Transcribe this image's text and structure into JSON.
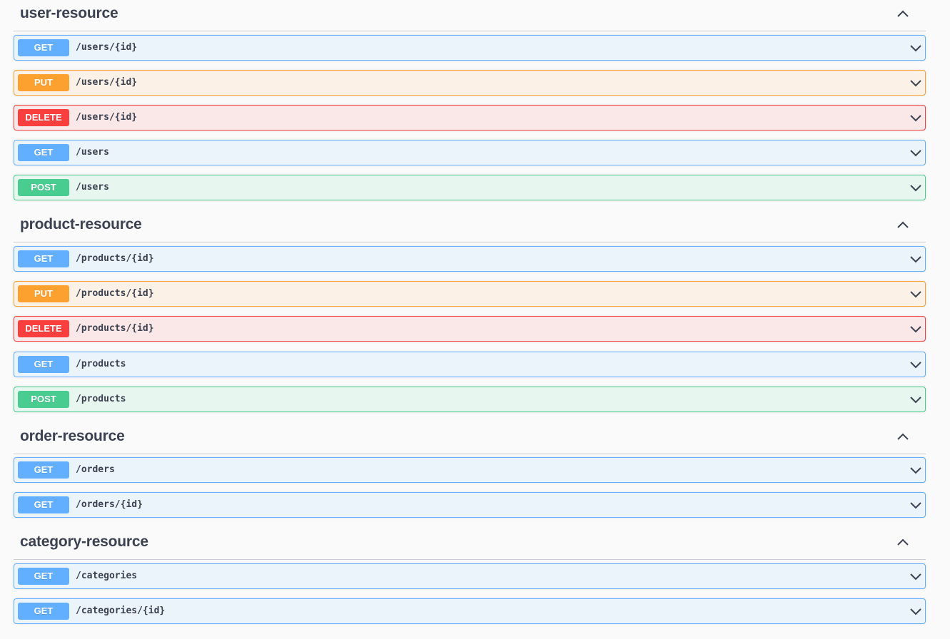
{
  "sections": [
    {
      "title": "user-resource",
      "operations": [
        {
          "method": "GET",
          "path": "/users/{id}"
        },
        {
          "method": "PUT",
          "path": "/users/{id}"
        },
        {
          "method": "DELETE",
          "path": "/users/{id}"
        },
        {
          "method": "GET",
          "path": "/users"
        },
        {
          "method": "POST",
          "path": "/users"
        }
      ]
    },
    {
      "title": "product-resource",
      "operations": [
        {
          "method": "GET",
          "path": "/products/{id}"
        },
        {
          "method": "PUT",
          "path": "/products/{id}"
        },
        {
          "method": "DELETE",
          "path": "/products/{id}"
        },
        {
          "method": "GET",
          "path": "/products"
        },
        {
          "method": "POST",
          "path": "/products"
        }
      ]
    },
    {
      "title": "order-resource",
      "operations": [
        {
          "method": "GET",
          "path": "/orders"
        },
        {
          "method": "GET",
          "path": "/orders/{id}"
        }
      ]
    },
    {
      "title": "category-resource",
      "operations": [
        {
          "method": "GET",
          "path": "/categories"
        },
        {
          "method": "GET",
          "path": "/categories/{id}"
        }
      ]
    }
  ],
  "colors": {
    "GET": "#61affe",
    "PUT": "#fca130",
    "DELETE": "#f93e3e",
    "POST": "#49cc90"
  },
  "icons": {
    "section_toggle": "chevron-up-icon",
    "operation_toggle": "chevron-down-icon"
  }
}
